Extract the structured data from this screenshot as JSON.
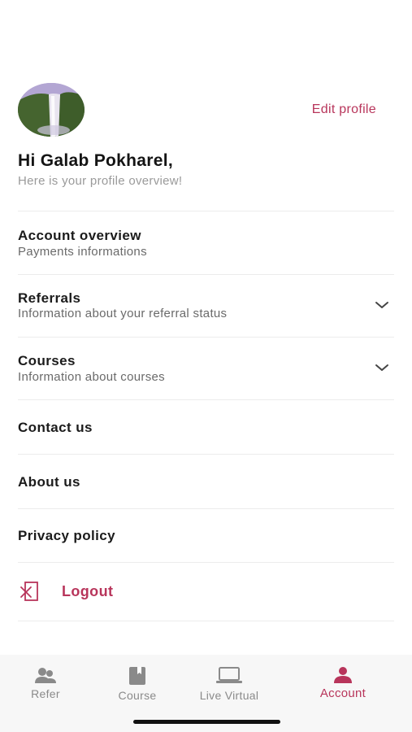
{
  "profile": {
    "edit_label": "Edit profile",
    "greeting": "Hi Galab Pokharel,",
    "subtitle": "Here is your profile overview!"
  },
  "menu": {
    "account_overview": {
      "title": "Account overview",
      "subtitle": "Payments informations"
    },
    "referrals": {
      "title": "Referrals",
      "subtitle": "Information about your referral status",
      "icon": "chevron-down-icon"
    },
    "courses": {
      "title": "Courses",
      "subtitle": "Information about courses",
      "icon": "chevron-down-icon"
    },
    "contact": {
      "title": "Contact us"
    },
    "about": {
      "title": "About us"
    },
    "privacy": {
      "title": "Privacy policy"
    },
    "logout": {
      "title": "Logout",
      "icon": "logout-icon"
    }
  },
  "nav": {
    "items": [
      {
        "label": "Refer",
        "icon": "users-icon",
        "active": false
      },
      {
        "label": "Course",
        "icon": "book-icon",
        "active": false
      },
      {
        "label": "Live Virtual",
        "icon": "laptop-icon",
        "active": false
      },
      {
        "label": "Account",
        "icon": "person-icon",
        "active": true
      }
    ]
  },
  "colors": {
    "accent": "#b8355b",
    "text": "#1b1b1b",
    "muted": "#6a6a6a",
    "nav_inactive": "#8a8a8a",
    "nav_background": "#f7f7f7"
  }
}
